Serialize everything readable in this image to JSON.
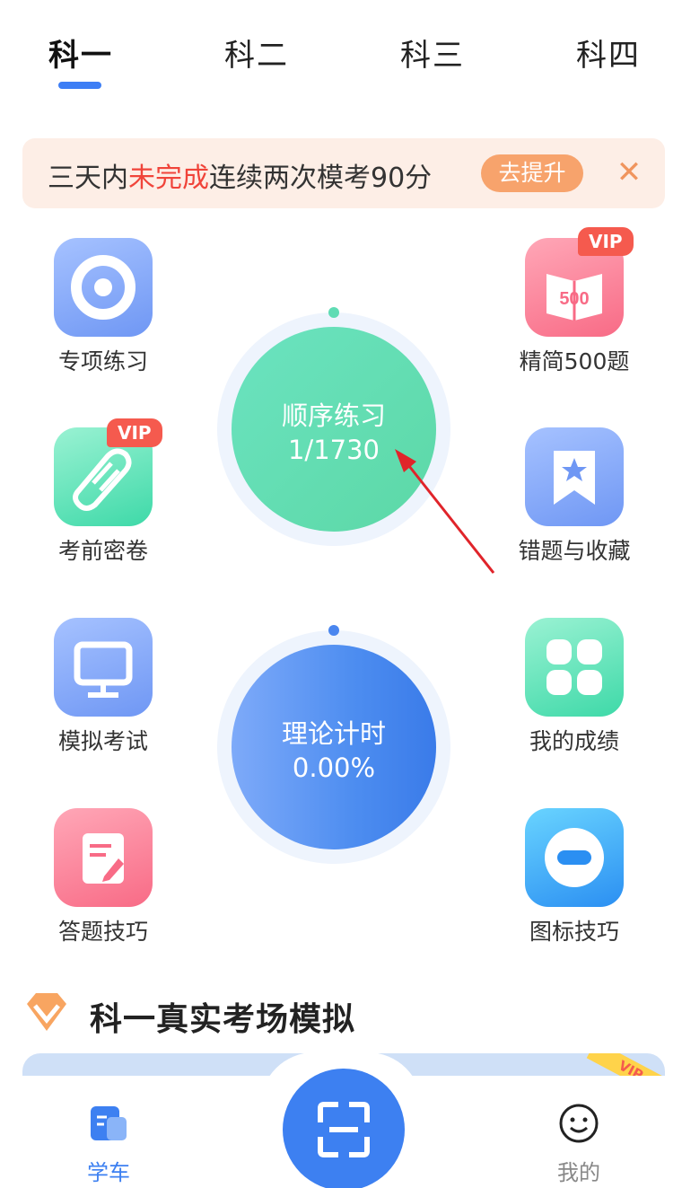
{
  "tabs": [
    "科一",
    "科二",
    "科三",
    "科四"
  ],
  "banner": {
    "text_before": "三天内",
    "text_highlight": "未完成",
    "text_after": "连续两次模考90分",
    "button": "去提升",
    "close": "✕"
  },
  "left_items": [
    {
      "label": "专项练习",
      "icon": "target-icon"
    },
    {
      "label": "考前密卷",
      "icon": "scroll-icon",
      "badge": "VIP"
    },
    {
      "label": "模拟考试",
      "icon": "monitor-icon"
    },
    {
      "label": "答题技巧",
      "icon": "note-edit-icon"
    }
  ],
  "right_items": [
    {
      "label": "精简500题",
      "icon": "book-500-icon",
      "badge": "VIP",
      "icon_text": "500"
    },
    {
      "label": "错题与收藏",
      "icon": "bookmark-star-icon"
    },
    {
      "label": "我的成绩",
      "icon": "grid-icon"
    },
    {
      "label": "图标技巧",
      "icon": "minus-circle-icon"
    }
  ],
  "practice_circle": {
    "title": "顺序练习",
    "value": "1/1730"
  },
  "timer_circle": {
    "title": "理论计时",
    "value": "0.00%"
  },
  "section": {
    "title": "科一真实考场模拟",
    "badge": "VIP"
  },
  "bottom_nav": {
    "study": "学车",
    "mine": "我的"
  },
  "colors": {
    "accent": "#3d7ef5",
    "highlight": "#f0443a",
    "banner_bg": "#fdeee6",
    "vip": "#f55a4e"
  }
}
